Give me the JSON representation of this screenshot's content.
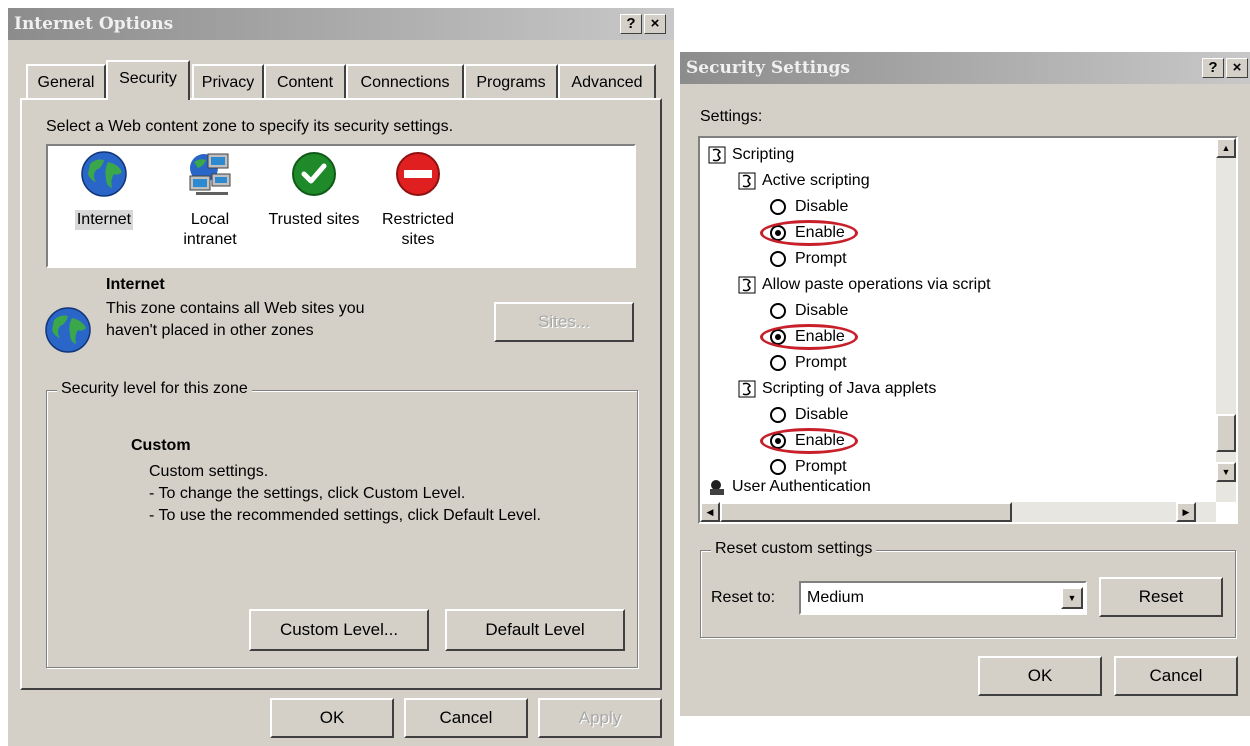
{
  "internet_options": {
    "title": "Internet Options",
    "help_btn": "?",
    "close_btn": "×",
    "tabs": [
      {
        "label": "General"
      },
      {
        "label": "Security"
      },
      {
        "label": "Privacy"
      },
      {
        "label": "Content"
      },
      {
        "label": "Connections"
      },
      {
        "label": "Programs"
      },
      {
        "label": "Advanced"
      }
    ],
    "active_tab": "Security",
    "instruction": "Select a Web content zone to specify its security settings.",
    "zones": [
      {
        "label": "Internet",
        "icon": "globe-icon"
      },
      {
        "label": "Local intranet",
        "icon": "network-computers-icon"
      },
      {
        "label": "Trusted sites",
        "icon": "checkmark-icon"
      },
      {
        "label": "Restricted sites",
        "icon": "no-entry-icon"
      }
    ],
    "selected_zone": {
      "name": "Internet",
      "description_line1": "This zone contains all Web sites you",
      "description_line2": "haven't placed in other zones",
      "sites_button": "Sites..."
    },
    "security_level": {
      "group_label": "Security level for this zone",
      "level_name": "Custom",
      "line1": "Custom settings.",
      "line2": "- To change the settings, click Custom Level.",
      "line3": "- To use the recommended settings, click Default Level."
    },
    "custom_level_button": "Custom Level...",
    "default_level_button": "Default Level",
    "ok_button": "OK",
    "cancel_button": "Cancel",
    "apply_button": "Apply"
  },
  "security_settings": {
    "title": "Security Settings",
    "help_btn": "?",
    "close_btn": "×",
    "settings_label": "Settings:",
    "category": "Scripting",
    "items": [
      {
        "label": "Active scripting",
        "options": [
          "Disable",
          "Enable",
          "Prompt"
        ],
        "selected": "Enable"
      },
      {
        "label": "Allow paste operations via script",
        "options": [
          "Disable",
          "Enable",
          "Prompt"
        ],
        "selected": "Enable"
      },
      {
        "label": "Scripting of Java applets",
        "options": [
          "Disable",
          "Enable",
          "Prompt"
        ],
        "selected": "Enable"
      }
    ],
    "next_category_partial": "User Authentication",
    "reset_group_label": "Reset custom settings",
    "reset_to_label": "Reset to:",
    "reset_to_value": "Medium",
    "reset_button": "Reset",
    "ok_button": "OK",
    "cancel_button": "Cancel",
    "highlight_color": "#c8202a"
  }
}
